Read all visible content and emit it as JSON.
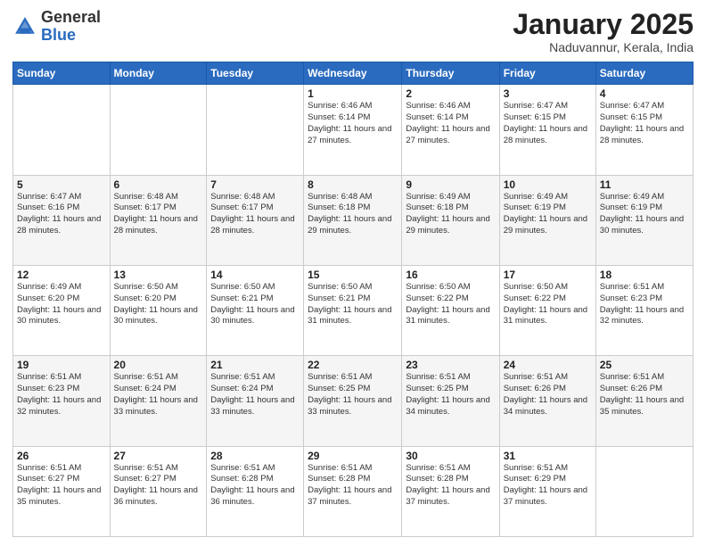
{
  "header": {
    "logo_general": "General",
    "logo_blue": "Blue",
    "title": "January 2025",
    "location": "Naduvannur, Kerala, India"
  },
  "days_of_week": [
    "Sunday",
    "Monday",
    "Tuesday",
    "Wednesday",
    "Thursday",
    "Friday",
    "Saturday"
  ],
  "weeks": [
    [
      {
        "day": "",
        "info": ""
      },
      {
        "day": "",
        "info": ""
      },
      {
        "day": "",
        "info": ""
      },
      {
        "day": "1",
        "info": "Sunrise: 6:46 AM\nSunset: 6:14 PM\nDaylight: 11 hours and 27 minutes."
      },
      {
        "day": "2",
        "info": "Sunrise: 6:46 AM\nSunset: 6:14 PM\nDaylight: 11 hours and 27 minutes."
      },
      {
        "day": "3",
        "info": "Sunrise: 6:47 AM\nSunset: 6:15 PM\nDaylight: 11 hours and 28 minutes."
      },
      {
        "day": "4",
        "info": "Sunrise: 6:47 AM\nSunset: 6:15 PM\nDaylight: 11 hours and 28 minutes."
      }
    ],
    [
      {
        "day": "5",
        "info": "Sunrise: 6:47 AM\nSunset: 6:16 PM\nDaylight: 11 hours and 28 minutes."
      },
      {
        "day": "6",
        "info": "Sunrise: 6:48 AM\nSunset: 6:17 PM\nDaylight: 11 hours and 28 minutes."
      },
      {
        "day": "7",
        "info": "Sunrise: 6:48 AM\nSunset: 6:17 PM\nDaylight: 11 hours and 28 minutes."
      },
      {
        "day": "8",
        "info": "Sunrise: 6:48 AM\nSunset: 6:18 PM\nDaylight: 11 hours and 29 minutes."
      },
      {
        "day": "9",
        "info": "Sunrise: 6:49 AM\nSunset: 6:18 PM\nDaylight: 11 hours and 29 minutes."
      },
      {
        "day": "10",
        "info": "Sunrise: 6:49 AM\nSunset: 6:19 PM\nDaylight: 11 hours and 29 minutes."
      },
      {
        "day": "11",
        "info": "Sunrise: 6:49 AM\nSunset: 6:19 PM\nDaylight: 11 hours and 30 minutes."
      }
    ],
    [
      {
        "day": "12",
        "info": "Sunrise: 6:49 AM\nSunset: 6:20 PM\nDaylight: 11 hours and 30 minutes."
      },
      {
        "day": "13",
        "info": "Sunrise: 6:50 AM\nSunset: 6:20 PM\nDaylight: 11 hours and 30 minutes."
      },
      {
        "day": "14",
        "info": "Sunrise: 6:50 AM\nSunset: 6:21 PM\nDaylight: 11 hours and 30 minutes."
      },
      {
        "day": "15",
        "info": "Sunrise: 6:50 AM\nSunset: 6:21 PM\nDaylight: 11 hours and 31 minutes."
      },
      {
        "day": "16",
        "info": "Sunrise: 6:50 AM\nSunset: 6:22 PM\nDaylight: 11 hours and 31 minutes."
      },
      {
        "day": "17",
        "info": "Sunrise: 6:50 AM\nSunset: 6:22 PM\nDaylight: 11 hours and 31 minutes."
      },
      {
        "day": "18",
        "info": "Sunrise: 6:51 AM\nSunset: 6:23 PM\nDaylight: 11 hours and 32 minutes."
      }
    ],
    [
      {
        "day": "19",
        "info": "Sunrise: 6:51 AM\nSunset: 6:23 PM\nDaylight: 11 hours and 32 minutes."
      },
      {
        "day": "20",
        "info": "Sunrise: 6:51 AM\nSunset: 6:24 PM\nDaylight: 11 hours and 33 minutes."
      },
      {
        "day": "21",
        "info": "Sunrise: 6:51 AM\nSunset: 6:24 PM\nDaylight: 11 hours and 33 minutes."
      },
      {
        "day": "22",
        "info": "Sunrise: 6:51 AM\nSunset: 6:25 PM\nDaylight: 11 hours and 33 minutes."
      },
      {
        "day": "23",
        "info": "Sunrise: 6:51 AM\nSunset: 6:25 PM\nDaylight: 11 hours and 34 minutes."
      },
      {
        "day": "24",
        "info": "Sunrise: 6:51 AM\nSunset: 6:26 PM\nDaylight: 11 hours and 34 minutes."
      },
      {
        "day": "25",
        "info": "Sunrise: 6:51 AM\nSunset: 6:26 PM\nDaylight: 11 hours and 35 minutes."
      }
    ],
    [
      {
        "day": "26",
        "info": "Sunrise: 6:51 AM\nSunset: 6:27 PM\nDaylight: 11 hours and 35 minutes."
      },
      {
        "day": "27",
        "info": "Sunrise: 6:51 AM\nSunset: 6:27 PM\nDaylight: 11 hours and 36 minutes."
      },
      {
        "day": "28",
        "info": "Sunrise: 6:51 AM\nSunset: 6:28 PM\nDaylight: 11 hours and 36 minutes."
      },
      {
        "day": "29",
        "info": "Sunrise: 6:51 AM\nSunset: 6:28 PM\nDaylight: 11 hours and 37 minutes."
      },
      {
        "day": "30",
        "info": "Sunrise: 6:51 AM\nSunset: 6:28 PM\nDaylight: 11 hours and 37 minutes."
      },
      {
        "day": "31",
        "info": "Sunrise: 6:51 AM\nSunset: 6:29 PM\nDaylight: 11 hours and 37 minutes."
      },
      {
        "day": "",
        "info": ""
      }
    ]
  ]
}
